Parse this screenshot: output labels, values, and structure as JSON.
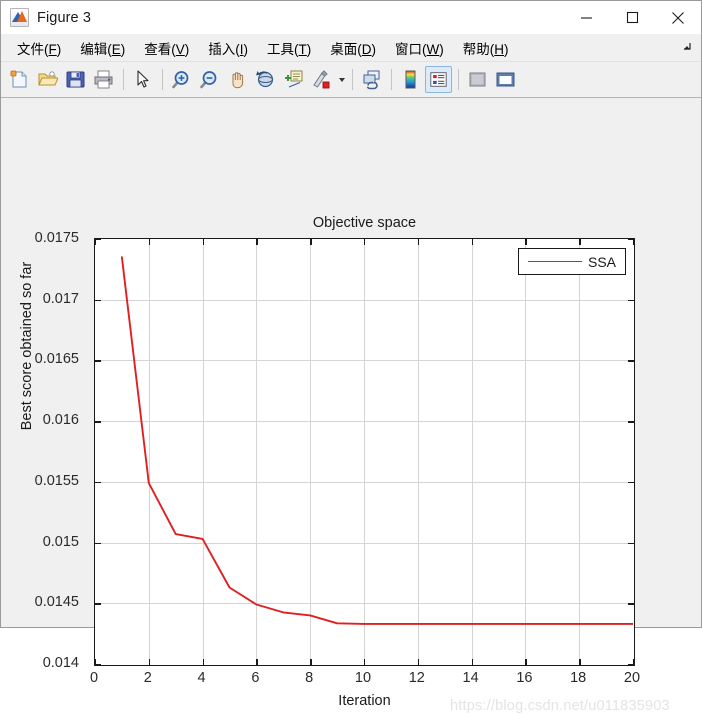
{
  "window": {
    "title": "Figure 3",
    "app_icon": "matlab-figure-icon",
    "controls": {
      "minimize": "minimize-icon",
      "maximize": "maximize-icon",
      "close": "close-icon"
    }
  },
  "menubar": {
    "items": [
      {
        "label": "文件(F)",
        "text": "文件(",
        "key": "F",
        "tail": ")"
      },
      {
        "label": "编辑(E)",
        "text": "编辑(",
        "key": "E",
        "tail": ")"
      },
      {
        "label": "查看(V)",
        "text": "查看(",
        "key": "V",
        "tail": ")"
      },
      {
        "label": "插入(I)",
        "text": "插入(",
        "key": "I",
        "tail": ")"
      },
      {
        "label": "工具(T)",
        "text": "工具(",
        "key": "T",
        "tail": ")"
      },
      {
        "label": "桌面(D)",
        "text": "桌面(",
        "key": "D",
        "tail": ")"
      },
      {
        "label": "窗口(W)",
        "text": "窗口(",
        "key": "W",
        "tail": ")"
      },
      {
        "label": "帮助(H)",
        "text": "帮助(",
        "key": "H",
        "tail": ")"
      }
    ],
    "undock_icon": "undock-arrow-icon"
  },
  "toolbar": {
    "buttons": [
      {
        "name": "new-figure-icon"
      },
      {
        "name": "open-file-icon"
      },
      {
        "name": "save-figure-icon"
      },
      {
        "name": "print-figure-icon"
      },
      {
        "name": "pointer-select-icon"
      },
      {
        "name": "zoom-in-icon"
      },
      {
        "name": "zoom-out-icon"
      },
      {
        "name": "pan-icon"
      },
      {
        "name": "rotate-3d-icon"
      },
      {
        "name": "insert-data-cursor-icon"
      },
      {
        "name": "brush-data-icon"
      },
      {
        "name": "link-plot-icon"
      },
      {
        "name": "insert-colorbar-icon"
      },
      {
        "name": "insert-legend-icon"
      },
      {
        "name": "hide-plot-tools-icon"
      },
      {
        "name": "show-plot-tools-icon"
      }
    ]
  },
  "chart_data": {
    "type": "line",
    "title": "Objective space",
    "xlabel": "Iteration",
    "ylabel": "Best score obtained so far",
    "xlim": [
      0,
      20
    ],
    "ylim": [
      0.014,
      0.0175
    ],
    "xticks": [
      0,
      2,
      4,
      6,
      8,
      10,
      12,
      14,
      16,
      18,
      20
    ],
    "yticks": [
      0.014,
      0.0145,
      0.015,
      0.0155,
      0.016,
      0.0165,
      0.017,
      0.0175
    ],
    "ytick_labels": [
      "0.014",
      "0.0145",
      "0.015",
      "0.0155",
      "0.016",
      "0.0165",
      "0.017",
      "0.0175"
    ],
    "xtick_labels": [
      "0",
      "2",
      "4",
      "6",
      "8",
      "10",
      "12",
      "14",
      "16",
      "18",
      "20"
    ],
    "grid": true,
    "legend": {
      "position": "top-right",
      "entries": [
        "SSA"
      ]
    },
    "series": [
      {
        "name": "SSA",
        "color": "#e02020",
        "x": [
          1,
          2,
          3,
          4,
          5,
          6,
          7,
          8,
          9,
          10,
          11,
          12,
          13,
          14,
          15,
          16,
          17,
          18,
          19,
          20
        ],
        "values": [
          0.01735,
          0.01549,
          0.01507,
          0.01503,
          0.01463,
          0.01449,
          0.014425,
          0.0144,
          0.014335,
          0.01433,
          0.01433,
          0.01433,
          0.01433,
          0.01433,
          0.01433,
          0.01433,
          0.01433,
          0.01433,
          0.01433,
          0.01433
        ]
      }
    ]
  },
  "watermark": {
    "text": "https://blog.csdn.net/u011835903"
  }
}
